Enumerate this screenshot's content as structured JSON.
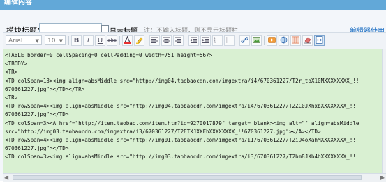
{
  "header": {
    "title": "编辑内容"
  },
  "form": {
    "module_title_label": "模块标题：",
    "title_input_value": "",
    "show_title_label": "显示标题",
    "note": "注：不输入标题，则不显示标题栏",
    "help_link": "编辑器使用"
  },
  "toolbar": {
    "font_select": "Arial",
    "size_select": "10",
    "bold_label": "B",
    "italic_label": "I",
    "underline_label": "U",
    "strike_label": "abc"
  },
  "editor": {
    "lines": [
      "<TABLE border=0 cellSpacing=0 cellPadding=0 width=751 height=567>",
      "<TBODY>",
      "<TR>",
      "<TD colSpan=13><img align=absMiddle src=\"http://img04.taobaocdn.com/imgextra/i4/670361227/T2r_toX10MXXXXXXXX_!!",
      "670361227.jpg\"></TD></TR>",
      "<TR>",
      "<TD rowSpan=4><img align=absMiddle src=\"http://img04.taobaocdn.com/imgextra/i4/670361227/T2ZC0JXhxbXXXXXXXX_!!",
      "670361227.jpg\"></TD>",
      "<TD colSpan=3><A href=\"http://item.taobao.com/item.htm?id=9270017879\" target=_blank><img alt=\"\" align=absMiddle",
      "src=\"http://img03.taobaocdn.com/imgextra/i3/670361227/T2ETXJXXFhXXXXXXXX_!!670361227.jpg\"></A></TD>",
      "<TD rowSpan=4><img align=absMiddle src=\"http://img01.taobaocdn.com/imgextra/i1/670361227/T2iD4oXahMXXXXXXXX_!!",
      "670361227.jpg\"></TD>",
      "<TD colSpan=3><img align=absMiddle src=\"http://img03.taobaocdn.com/imgextra/i3/670361227/T2bm8JXb4bXXXXXXXX_!!"
    ]
  }
}
